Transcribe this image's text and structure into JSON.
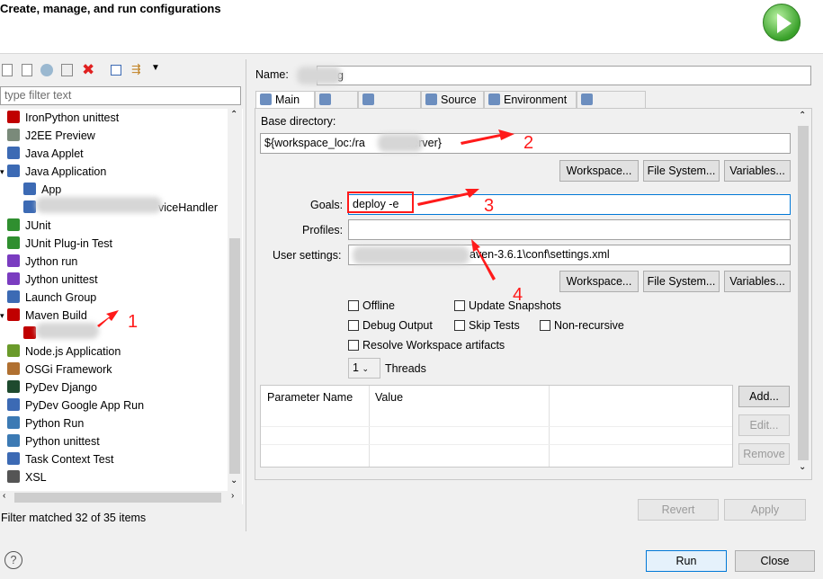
{
  "title": "Create, manage, and run configurations",
  "toolbar": {
    "icons": [
      "new-config-icon",
      "new-prototype-icon",
      "export-icon",
      "duplicate-icon",
      "delete-icon",
      "collapse-all-icon",
      "filter-icon",
      "dropdown-icon"
    ]
  },
  "filter": {
    "placeholder": "type filter text"
  },
  "tree": [
    {
      "label": "IronPython unittest",
      "icon": "python-unittest-icon",
      "color": "#c00000"
    },
    {
      "label": "J2EE Preview",
      "icon": "server-icon",
      "color": "#7a8a7a"
    },
    {
      "label": "Java Applet",
      "icon": "applet-icon",
      "color": "#3c6ab4"
    },
    {
      "label": "Java Application",
      "icon": "java-app-icon",
      "color": "#3c6ab4",
      "expanded": true
    },
    {
      "label": "App",
      "icon": "java-app-icon",
      "color": "#3c6ab4",
      "child": true
    },
    {
      "label": "viceHandler",
      "icon": "java-app-icon",
      "color": "#3c6ab4",
      "child": true,
      "blurred": true
    },
    {
      "label": "JUnit",
      "icon": "junit-icon",
      "color": "#2f8f2f"
    },
    {
      "label": "JUnit Plug-in Test",
      "icon": "junit-plugin-icon",
      "color": "#2f8f2f"
    },
    {
      "label": "Jython run",
      "icon": "jython-icon",
      "color": "#7a3cc0"
    },
    {
      "label": "Jython unittest",
      "icon": "jython-unittest-icon",
      "color": "#7a3cc0"
    },
    {
      "label": "Launch Group",
      "icon": "launch-group-icon",
      "color": "#3c6ab4"
    },
    {
      "label": "Maven Build",
      "icon": "maven-icon",
      "color": "#c00000",
      "expanded": true
    },
    {
      "label": "",
      "icon": "maven-icon",
      "color": "#c00000",
      "child": true,
      "blurred": true
    },
    {
      "label": "Node.js Application",
      "icon": "nodejs-icon",
      "color": "#6a9a2a"
    },
    {
      "label": "OSGi Framework",
      "icon": "osgi-icon",
      "color": "#b07030"
    },
    {
      "label": "PyDev Django",
      "icon": "django-icon",
      "color": "#1e4a2e"
    },
    {
      "label": "PyDev Google App Run",
      "icon": "google-app-icon",
      "color": "#3c6ab4"
    },
    {
      "label": "Python Run",
      "icon": "python-icon",
      "color": "#3c7ab4"
    },
    {
      "label": "Python unittest",
      "icon": "python-unittest-icon",
      "color": "#3c7ab4"
    },
    {
      "label": "Task Context Test",
      "icon": "task-icon",
      "color": "#3c6ab4"
    },
    {
      "label": "XSL",
      "icon": "xsl-icon",
      "color": "#555555"
    }
  ],
  "filter_status": "Filter matched 32 of 35 items",
  "name": {
    "label": "Name:",
    "value": "g"
  },
  "tabs": [
    {
      "label": "Main",
      "icon": "main-tab-icon",
      "active": true
    },
    {
      "label": "JRE",
      "icon": "jre-icon"
    },
    {
      "label": "Refresh",
      "icon": "refresh-icon"
    },
    {
      "label": "Source",
      "icon": "source-icon"
    },
    {
      "label": "Environment",
      "icon": "environment-icon"
    },
    {
      "label": "Common",
      "icon": "common-icon"
    }
  ],
  "main": {
    "base_dir_label": "Base directory:",
    "base_dir_value": "${workspace_loc:/ra",
    "base_dir_suffix": "-server}",
    "workspace_btn": "Workspace...",
    "filesystem_btn": "File System...",
    "variables_btn": "Variables...",
    "goals_label": "Goals:",
    "goals_value": "deploy -e",
    "profiles_label": "Profiles:",
    "profiles_value": "",
    "user_settings_label": "User settings:",
    "user_settings_value": "aven-3.6.1\\conf\\settings.xml",
    "checkboxes": [
      {
        "label": "Offline",
        "checked": false
      },
      {
        "label": "Update Snapshots",
        "checked": false
      },
      {
        "label": "Debug Output",
        "checked": false
      },
      {
        "label": "Skip Tests",
        "checked": false
      },
      {
        "label": "Non-recursive",
        "checked": false
      },
      {
        "label": "Resolve Workspace artifacts",
        "checked": false
      }
    ],
    "threads_value": "1",
    "threads_label": "Threads",
    "param_headers": [
      "Parameter Name",
      "Value"
    ],
    "add_btn": "Add...",
    "edit_btn": "Edit...",
    "remove_btn": "Remove"
  },
  "revert_btn": "Revert",
  "apply_btn": "Apply",
  "run_btn": "Run",
  "close_btn": "Close",
  "annotations": [
    "1",
    "2",
    "3",
    "4"
  ],
  "annotation_color": "#ff1a1a"
}
